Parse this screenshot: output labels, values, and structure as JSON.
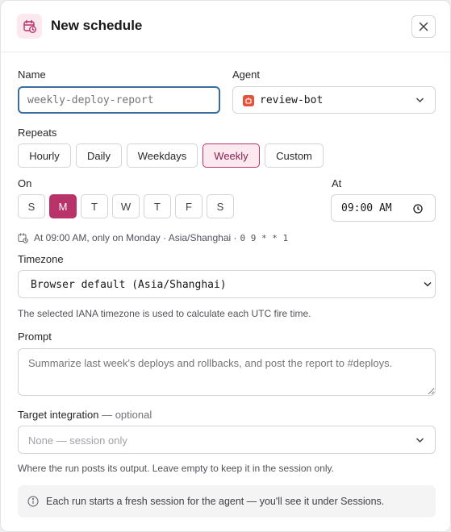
{
  "dialog": {
    "title": "New schedule",
    "icon": "calendar-clock-icon",
    "close_icon": "close-icon"
  },
  "name": {
    "label": "Name",
    "placeholder": "weekly-deploy-report",
    "value": ""
  },
  "agent": {
    "label": "Agent",
    "value": "review-bot",
    "icon": "agent-bot-icon"
  },
  "repeats": {
    "label": "Repeats",
    "options": [
      "Hourly",
      "Daily",
      "Weekdays",
      "Weekly",
      "Custom"
    ],
    "selected": "Weekly"
  },
  "on": {
    "label": "On",
    "days": [
      "S",
      "M",
      "T",
      "W",
      "T",
      "F",
      "S"
    ],
    "selected": [
      "M"
    ]
  },
  "at": {
    "label": "At",
    "value": "09:00 AM",
    "icon": "clock-icon"
  },
  "summary": {
    "text": "At 09:00 AM, only on Monday · Asia/Shanghai ·",
    "cron": "0 9 * * 1",
    "icon": "calendar-clock-icon"
  },
  "timezone": {
    "label": "Timezone",
    "value": "Browser default (Asia/Shanghai)",
    "help": "The selected IANA timezone is used to calculate each UTC fire time."
  },
  "prompt": {
    "label": "Prompt",
    "placeholder": "Summarize last week's deploys and rollbacks, and post the report to #deploys."
  },
  "target": {
    "label": "Target integration",
    "optional": "— optional",
    "value": "None — session only",
    "help": "Where the run posts its output. Leave empty to keep it in the session only."
  },
  "info": {
    "text": "Each run starts a fresh session for the agent — you'll see it under Sessions.",
    "icon": "info-icon"
  },
  "colors": {
    "accent": "#b8336a",
    "accent_bg": "#fbe9ef",
    "focus_ring": "#3b6e9e"
  }
}
